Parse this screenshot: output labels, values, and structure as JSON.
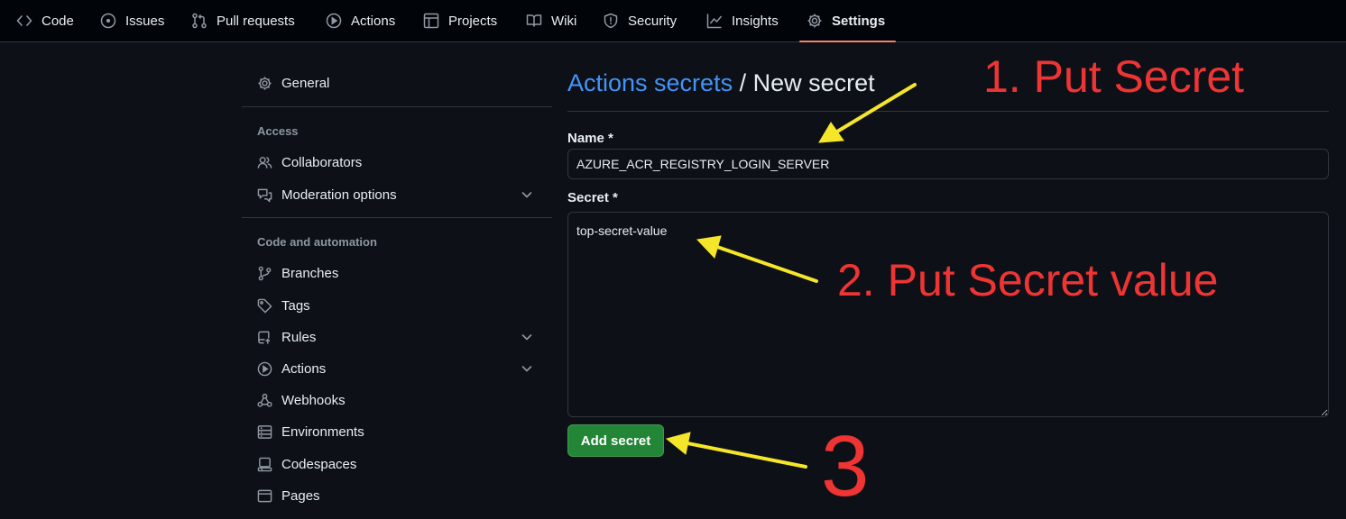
{
  "nav": {
    "tabs": [
      {
        "label": "Code",
        "icon": "code-icon"
      },
      {
        "label": "Issues",
        "icon": "issue-icon"
      },
      {
        "label": "Pull requests",
        "icon": "pull-request-icon"
      },
      {
        "label": "Actions",
        "icon": "play-icon"
      },
      {
        "label": "Projects",
        "icon": "table-icon"
      },
      {
        "label": "Wiki",
        "icon": "book-icon"
      },
      {
        "label": "Security",
        "icon": "shield-icon"
      },
      {
        "label": "Insights",
        "icon": "graph-icon"
      },
      {
        "label": "Settings",
        "icon": "gear-icon",
        "selected": true
      }
    ]
  },
  "sidebar": {
    "general": "General",
    "access_heading": "Access",
    "access_items": [
      "Collaborators",
      "Moderation options"
    ],
    "code_heading": "Code and automation",
    "code_items": [
      "Branches",
      "Tags",
      "Rules",
      "Actions",
      "Webhooks",
      "Environments",
      "Codespaces",
      "Pages"
    ]
  },
  "main": {
    "breadcrumb_link": "Actions secrets",
    "breadcrumb_rest": " / New secret",
    "name_label": "Name *",
    "name_value": "AZURE_ACR_REGISTRY_LOGIN_SERVER",
    "secret_label": "Secret *",
    "secret_value": "top-secret-value",
    "submit_label": "Add secret"
  },
  "annotations": {
    "step1": "1. Put Secret",
    "step2": "2. Put Secret value",
    "step3": "3"
  },
  "colors": {
    "background": "#0d1117",
    "header_background": "#010409",
    "link": "#4493f8",
    "selected_underline": "#f78166",
    "button": "#238636",
    "annotation_text": "#ef3434",
    "arrow": "#f5e62a"
  }
}
